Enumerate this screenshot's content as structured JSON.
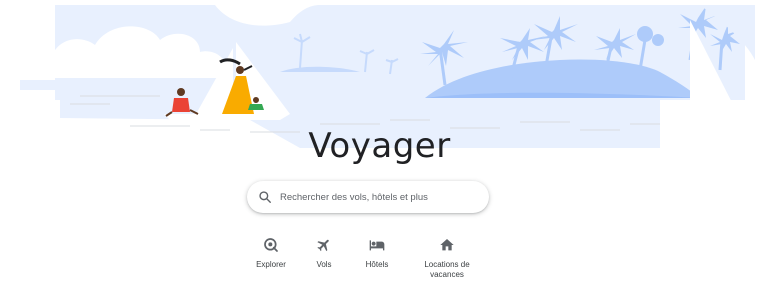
{
  "app": {
    "title": "Voyager"
  },
  "search": {
    "placeholder": "Rechercher des vols, hôtels et plus",
    "value": ""
  },
  "categories": [
    {
      "label": "Explorer",
      "icon": "explore-icon"
    },
    {
      "label": "Vols",
      "icon": "flight-icon"
    },
    {
      "label": "Hôtels",
      "icon": "hotel-bed-icon"
    },
    {
      "label": "Locations de vacances",
      "icon": "home-icon"
    }
  ],
  "colors": {
    "sky": "#e8f0fe",
    "palm": "#aecbfa",
    "text": "#202124",
    "icon": "#5f6368",
    "dress": "#f9ab00",
    "shirt": "#ea4335"
  }
}
